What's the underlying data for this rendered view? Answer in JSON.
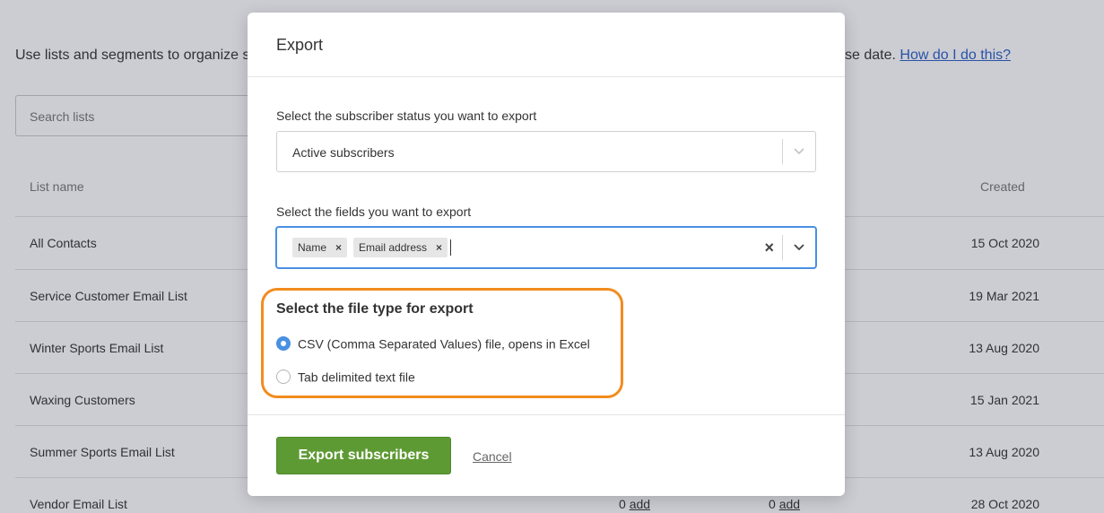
{
  "background": {
    "intro_left": "Use lists and segments to organize s",
    "intro_right": "se date.",
    "help_link": "How do I do this?",
    "search_placeholder": "Search lists",
    "columns": {
      "list_name": "List name",
      "created": "Created"
    },
    "rows": [
      {
        "name": "All Contacts",
        "created": "15 Oct 2020"
      },
      {
        "name": "Service Customer Email List",
        "created": "19 Mar 2021"
      },
      {
        "name": "Winter Sports Email List",
        "created": "13 Aug 2020"
      },
      {
        "name": "Waxing Customers",
        "created": "15 Jan 2021"
      },
      {
        "name": "Summer Sports Email List",
        "created": "13 Aug 2020"
      },
      {
        "name": "Vendor Email List",
        "created": "28 Oct 2020",
        "count1": "0",
        "count2": "0",
        "add_label": "add"
      }
    ]
  },
  "modal": {
    "title": "Export",
    "status_label": "Select the subscriber status you want to export",
    "status_value": "Active subscribers",
    "fields_label": "Select the fields you want to export",
    "fields": [
      {
        "label": "Name",
        "remove": "×"
      },
      {
        "label": "Email address",
        "remove": "×"
      }
    ],
    "clear_symbol": "×",
    "file_type_title": "Select the file type for export",
    "file_types": [
      {
        "label": "CSV (Comma Separated Values) file, opens in Excel",
        "selected": true
      },
      {
        "label": "Tab delimited text file",
        "selected": false
      }
    ],
    "export_button": "Export subscribers",
    "cancel_link": "Cancel"
  },
  "colors": {
    "accent_blue": "#4a90e2",
    "export_green": "#5e9a34",
    "highlight_orange": "#f28c1e"
  }
}
